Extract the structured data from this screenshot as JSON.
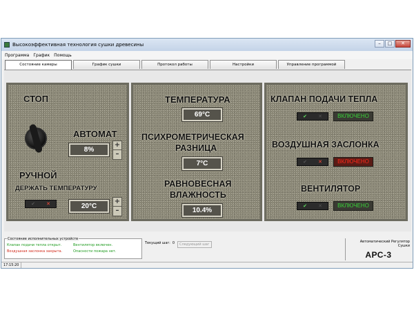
{
  "window": {
    "title": "Высокоэффективная технология сушки древесины",
    "controls": {
      "minimize": "–",
      "maximize": "□",
      "close": "✕"
    }
  },
  "menu": [
    "Программа",
    "График",
    "Помощь"
  ],
  "tabs": [
    "Состояние камеры",
    "График сушки",
    "Протокол работы",
    "Настройки",
    "Управление программой"
  ],
  "left_panel": {
    "stop_label": "СТОП",
    "auto_label": "АВТОМАТ",
    "auto_value": "8%",
    "manual_label": "РУЧНОЙ",
    "hold_temp_label": "ДЕРЖАТЬ ТЕМПЕРАТУРУ",
    "hold_temp_value": "20°С",
    "stepper_up": "+",
    "stepper_down": "–"
  },
  "middle_panel": {
    "temperature_label": "ТЕМПЕРАТУРА",
    "temperature_value": "69°С",
    "psychro_label_1": "ПСИХРОМЕТРИЧЕСКАЯ",
    "psychro_label_2": "РАЗНИЦА",
    "psychro_value": "7°С",
    "equil_label_1": "РАВНОВЕСНАЯ",
    "equil_label_2": "ВЛАЖНОСТЬ",
    "equil_value": "10.4%"
  },
  "right_panel": {
    "heat_valve_label": "КЛАПАН ПОДАЧИ ТЕПЛА",
    "heat_valve_state": "ВКЛЮЧЕНО",
    "air_damper_label": "ВОЗДУШНАЯ ЗАСЛОНКА",
    "air_damper_state": "ВКЛЮЧЕНО",
    "fan_label": "ВЕНТИЛЯТОР",
    "fan_state": "ВКЛЮЧЕНО",
    "toggle_check": "✔",
    "toggle_cross": "✕"
  },
  "status": {
    "devices_title": "Состояние исполнительных устройств",
    "heat_valve_msg": "Клапан подачи тепла открыт.",
    "fan_msg": "Вентилятор включен.",
    "damper_msg": "Воздушная заслонка закрыта.",
    "fire_msg": "Опасности пожара нет.",
    "step_label": "Текущий шаг:",
    "step_value": "0",
    "next_step_button": "Следующий шаг",
    "arc_title": "Автоматический Регулятор Сушки",
    "arc_logo": "АРС-3"
  },
  "clock": "17:15:20",
  "colors": {
    "on": "#39d339",
    "off": "#ff2a1a"
  }
}
